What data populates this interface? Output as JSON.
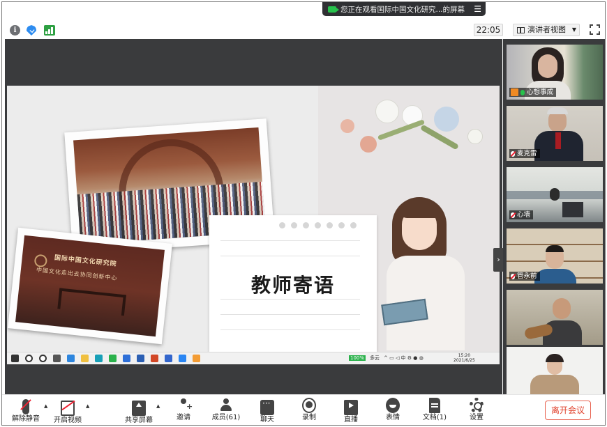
{
  "banner": {
    "text": "您正在观看国际中国文化研究...的屏幕",
    "menu_icon": "menu-lines-icon"
  },
  "info_row": {
    "time": "22:05",
    "view_mode": "演讲者视图"
  },
  "slide": {
    "title": "教师寄语",
    "building_sign_1": "国际中国文化研究院",
    "building_sign_2": "中国文化走出去协同创新中心",
    "taskbar_clock_time": "15:20",
    "taskbar_clock_date": "2021/6/25",
    "taskbar_battery": "100%",
    "taskbar_weather": "多云"
  },
  "participants": [
    {
      "name": "心想事成",
      "mic": "on",
      "host": true,
      "active": true
    },
    {
      "name": "麦克雷",
      "mic": "off",
      "host": false,
      "active": false
    },
    {
      "name": "心墙",
      "mic": "off",
      "host": false,
      "active": false
    },
    {
      "name": "管永前",
      "mic": "off",
      "host": false,
      "active": false
    },
    {
      "name": "",
      "mic": "",
      "host": false,
      "active": false
    },
    {
      "name": "",
      "mic": "",
      "host": false,
      "active": false
    }
  ],
  "toolbar": {
    "mute": "解除静音",
    "video": "开启视频",
    "share": "共享屏幕",
    "invite": "邀请",
    "members": "成员(61)",
    "chat": "聊天",
    "record": "录制",
    "live": "直播",
    "reactions": "表情",
    "docs": "文档(1)",
    "settings": "设置",
    "leave": "离开会议"
  },
  "colors": {
    "accent_green": "#27c24c",
    "leave_red": "#e0412c",
    "share_bg": "#3a3b3d",
    "shield_blue": "#2d8cf0"
  }
}
